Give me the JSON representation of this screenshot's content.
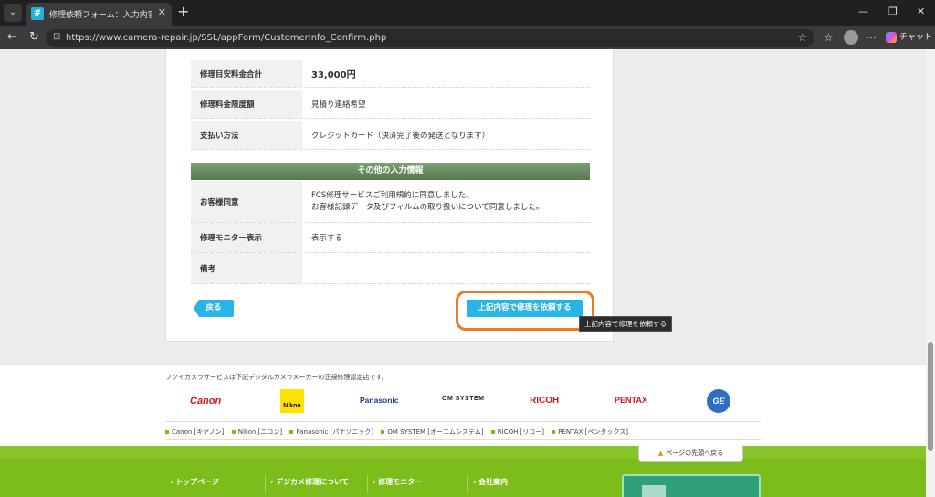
{
  "browser": {
    "tab_title": "修理依頼フォーム：入力内容確認 | ",
    "tab_favicon": "#",
    "url": "https://www.camera-repair.jp/SSL/appForm/CustomerInfo_Confirm.php",
    "chat_label": "チャット"
  },
  "form": {
    "rows_top": [
      {
        "label": "修理目安料金合計",
        "value": "33,000円"
      },
      {
        "label": "修理料金限度額",
        "value": "見積り連絡希望"
      },
      {
        "label": "支払い方法",
        "value": "クレジットカード（決済完了後の発送となります）"
      }
    ],
    "section_title": "その他の入力情報",
    "consent_label": "お客様同意",
    "consent_lines": [
      "FCS修理サービスご利用規約に同意しました。",
      "お客様記録データ及びフィルムの取り扱いについて同意しました。"
    ],
    "monitor_label": "修理モニター表示",
    "monitor_value": "表示する",
    "remarks_label": "備考",
    "remarks_value": ""
  },
  "actions": {
    "back_label": "戻る",
    "submit_label": "上記内容で修理を依頼する",
    "tooltip": "上記内容で修理を依頼する"
  },
  "footer": {
    "cert_text": "フクイカメラサービスは下記デジタルカメラメーカーの正規修理認定店です。",
    "logos": {
      "canon": "Canon",
      "nikon": "Nikon",
      "panasonic": "Panasonic",
      "om": "OM SYSTEM",
      "ricoh": "RICOH",
      "pentax": "PENTAX",
      "ge": "GE"
    },
    "maker_links": [
      "Canon [キヤノン]",
      "Nikon [ニコン]",
      "Panasonic [パナソニック]",
      "OM SYSTEM [オーエムシステム]",
      "RICOH [リコー]",
      "PENTAX [ペンタックス]"
    ],
    "to_top": "ページの先頭へ戻る",
    "nav": [
      "トップページ",
      "デジカメ修理について",
      "修理モニター",
      "会社案内"
    ]
  },
  "colors": {
    "accent_button": "#27b4e6",
    "highlight": "#f07a24",
    "section_green": "#56794d",
    "footer_green": "#7cbd1b"
  }
}
